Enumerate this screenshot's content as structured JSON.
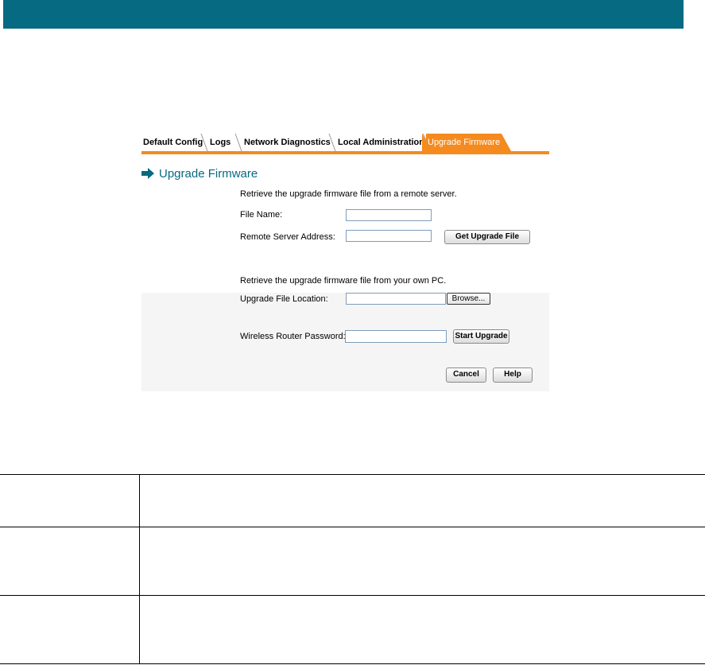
{
  "colors": {
    "header_bar": "#066a82",
    "accent": "#f58a1f",
    "heading": "#066a82"
  },
  "tabs": [
    {
      "label": "Default Config",
      "active": false
    },
    {
      "label": "Logs",
      "active": false
    },
    {
      "label": "Network Diagnostics",
      "active": false
    },
    {
      "label": "Local Administration",
      "active": false
    },
    {
      "label": "Upgrade Firmware",
      "active": true
    }
  ],
  "heading": {
    "icon": "arrow-right-icon",
    "title": "Upgrade Firmware"
  },
  "remote": {
    "intro": "Retrieve the upgrade firmware file from a remote server.",
    "file_name_label": "File Name:",
    "file_name_value": "",
    "server_label": "Remote Server Address:",
    "server_value": "",
    "get_button": "Get Upgrade File"
  },
  "local": {
    "intro": "Retrieve the upgrade firmware file from your own PC.",
    "location_label": "Upgrade File Location:",
    "location_value": "",
    "browse_button": "Browse...",
    "password_label": "Wireless Router Password:",
    "password_value": "",
    "start_button": "Start Upgrade"
  },
  "footer_buttons": {
    "cancel": "Cancel",
    "help": "Help"
  },
  "table": {
    "rows": [
      {
        "term": "",
        "description": ""
      },
      {
        "term": "",
        "description": ""
      },
      {
        "term": "",
        "description": ""
      }
    ]
  }
}
